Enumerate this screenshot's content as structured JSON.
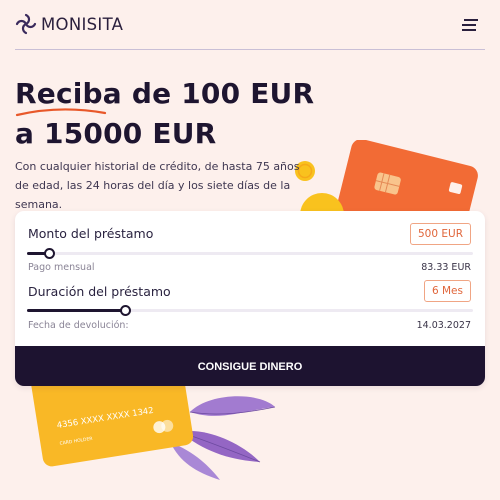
{
  "header": {
    "brand": "MONISITA",
    "logo_icon": "monisita-logo-icon",
    "menu_icon": "hamburger-menu-icon"
  },
  "hero": {
    "headline_line1": "Reciba de 100 EUR",
    "headline_line2": "a 15000 EUR",
    "subtitle": "Con cualquier historial de crédito, de hasta 75 años de edad, las 24 horas del día y los siete días de la semana."
  },
  "calculator": {
    "amount": {
      "label": "Monto del préstamo",
      "value": "500 EUR",
      "slider_fraction": 0.05
    },
    "monthly": {
      "label": "Pago mensual",
      "value": "83.33 EUR"
    },
    "duration": {
      "label": "Duración del préstamo",
      "value": "6 Mes",
      "slider_fraction": 0.22
    },
    "return_date": {
      "label": "Fecha de devolución:",
      "value": "14.03.2027"
    },
    "cta_label": "CONSIGUE DINERO"
  },
  "decor": {
    "yellow_card_number": "4356   XXXX   XXXX   1342",
    "yellow_card_holder": "CARD HOLDER"
  },
  "colors": {
    "accent": "#e8582a",
    "dark": "#1d1330",
    "background": "#fdf0ec",
    "card_orange": "#f26b35",
    "card_yellow": "#f9b826",
    "leaf_purple": "#9a6fc4",
    "coin": "#f8c21e"
  }
}
